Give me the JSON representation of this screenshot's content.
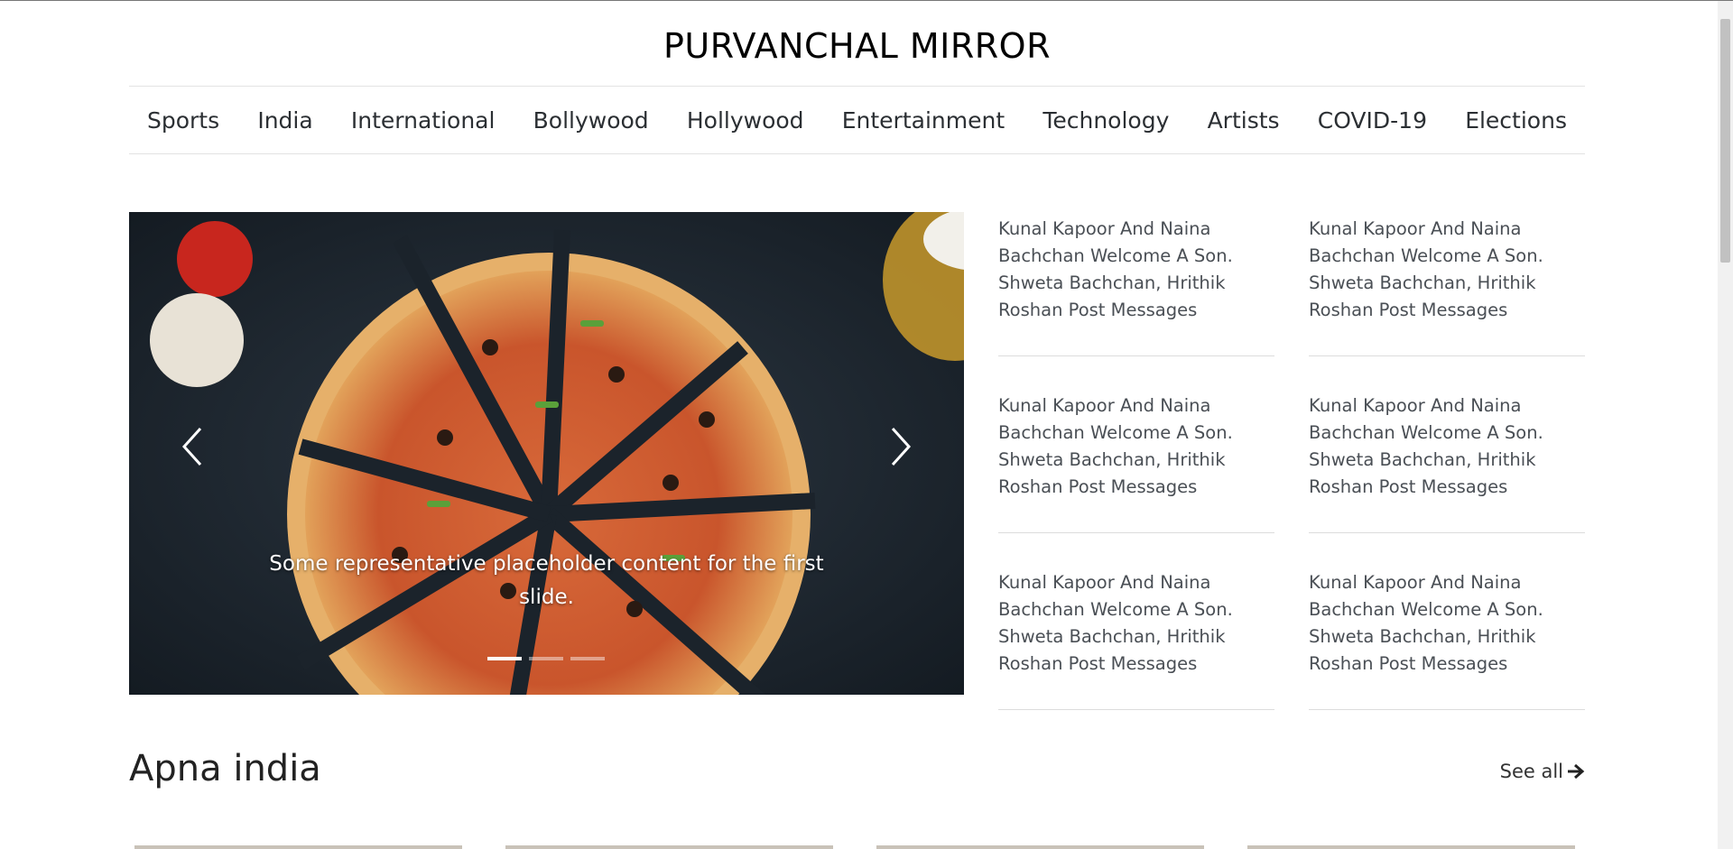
{
  "site": {
    "title": "PURVANCHAL MIRROR"
  },
  "nav": [
    {
      "label": "Sports"
    },
    {
      "label": "India"
    },
    {
      "label": "International"
    },
    {
      "label": "Bollywood"
    },
    {
      "label": "Hollywood"
    },
    {
      "label": "Entertainment"
    },
    {
      "label": "Technology"
    },
    {
      "label": "Artists"
    },
    {
      "label": "COVID-19"
    },
    {
      "label": "Elections"
    }
  ],
  "carousel": {
    "caption": "Some representative placeholder content for the first slide.",
    "slide_count": 3,
    "active_index": 0
  },
  "news": [
    {
      "title": "Kunal Kapoor And Naina Bachchan Welcome A Son. Shweta Bachchan, Hrithik Roshan Post Messages"
    },
    {
      "title": "Kunal Kapoor And Naina Bachchan Welcome A Son. Shweta Bachchan, Hrithik Roshan Post Messages"
    },
    {
      "title": "Kunal Kapoor And Naina Bachchan Welcome A Son. Shweta Bachchan, Hrithik Roshan Post Messages"
    },
    {
      "title": "Kunal Kapoor And Naina Bachchan Welcome A Son. Shweta Bachchan, Hrithik Roshan Post Messages"
    },
    {
      "title": "Kunal Kapoor And Naina Bachchan Welcome A Son. Shweta Bachchan, Hrithik Roshan Post Messages"
    },
    {
      "title": "Kunal Kapoor And Naina Bachchan Welcome A Son. Shweta Bachchan, Hrithik Roshan Post Messages"
    }
  ],
  "section": {
    "title": "Apna india",
    "see_all": "See all"
  },
  "icons": {
    "prev": "chevron-left-icon",
    "next": "chevron-right-icon",
    "see_all": "arrow-right-icon"
  },
  "colors": {
    "text": "#212529",
    "divider": "#dcdcdc"
  }
}
